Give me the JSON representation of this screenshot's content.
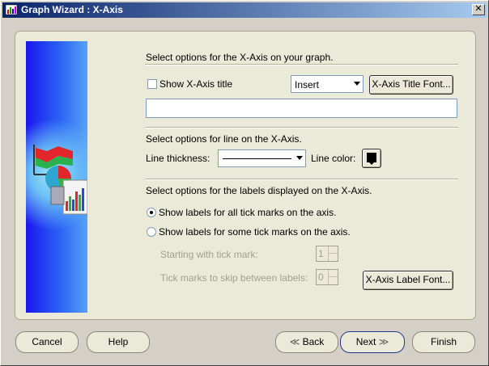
{
  "window": {
    "title": "Graph Wizard : X-Axis",
    "close_glyph": "✕"
  },
  "section_axis": {
    "heading": "Select options for the X-Axis on your graph.",
    "show_title_label": "Show X-Axis title",
    "show_title_checked": false,
    "position_select_value": "Insert",
    "title_font_button": "X-Axis Title Font...",
    "title_input_value": ""
  },
  "section_line": {
    "heading": "Select options for line on the X-Axis.",
    "thickness_label": "Line thickness:",
    "color_label": "Line color:",
    "line_color": "#000000"
  },
  "section_labels": {
    "heading": "Select options for the labels displayed on the X-Axis.",
    "option_all": "Show labels for all tick marks on the axis.",
    "option_all_selected": true,
    "option_some": "Show labels for some tick marks on the axis.",
    "option_some_selected": false,
    "starting_label": "Starting with tick mark:",
    "starting_value": "1",
    "skip_label": "Tick marks to skip between labels:",
    "skip_value": "0",
    "label_font_button": "X-Axis Label Font..."
  },
  "footer": {
    "cancel": "Cancel",
    "help": "Help",
    "back": "Back",
    "next": "Next",
    "finish": "Finish"
  },
  "colors": {
    "title_bar_start": "#0a246a",
    "title_bar_end": "#a6caf0",
    "panel_bg": "#ebe9d8",
    "banner_blue": "#1a16ef"
  }
}
